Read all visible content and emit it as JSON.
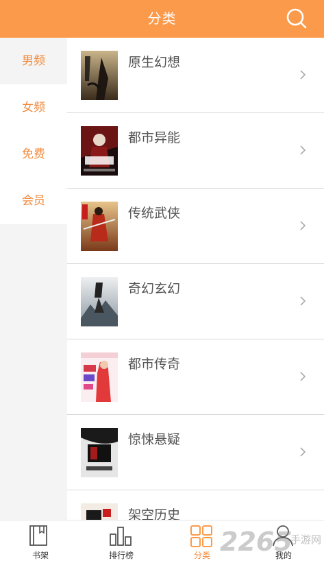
{
  "header": {
    "title": "分类"
  },
  "sidebar": {
    "items": [
      {
        "label": "男频",
        "active": true
      },
      {
        "label": "女频",
        "active": false
      },
      {
        "label": "免费",
        "active": false
      },
      {
        "label": "会员",
        "active": false
      }
    ]
  },
  "categories": [
    {
      "label": "原生幻想"
    },
    {
      "label": "都市异能"
    },
    {
      "label": "传统武侠"
    },
    {
      "label": "奇幻玄幻"
    },
    {
      "label": "都市传奇"
    },
    {
      "label": "惊悚悬疑"
    },
    {
      "label": "架空历史"
    }
  ],
  "tabbar": {
    "items": [
      {
        "label": "书架",
        "icon": "bookshelf-icon"
      },
      {
        "label": "排行榜",
        "icon": "ranking-icon"
      },
      {
        "label": "分类",
        "icon": "category-icon",
        "active": true
      },
      {
        "label": "我的",
        "icon": "profile-icon"
      }
    ]
  },
  "watermark": {
    "number": "2265",
    "text": "手游网"
  },
  "colors": {
    "accent": "#fb9a4a",
    "accent_text": "#f08a3c",
    "divider": "#d8d8d8"
  }
}
